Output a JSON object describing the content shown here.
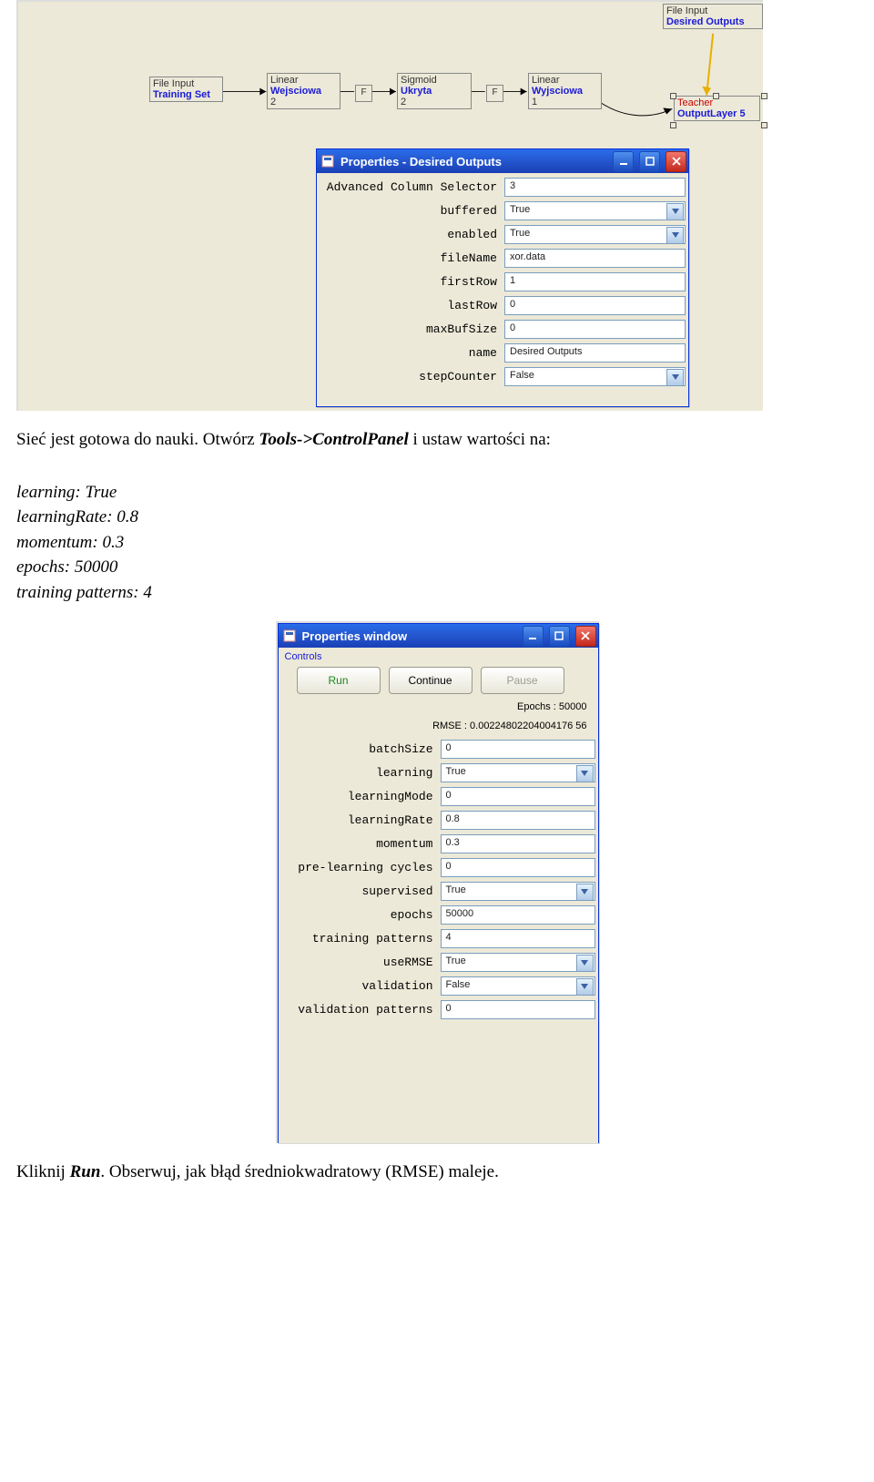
{
  "shot1": {
    "nodes": {
      "trainingSet": {
        "line1": "File Input",
        "line2": "Training Set"
      },
      "wejsciowa": {
        "line1": "Linear",
        "line2": "Wejsciowa",
        "line3": "2"
      },
      "ukryta": {
        "line1": "Sigmoid",
        "line2": "Ukryta",
        "line3": "2"
      },
      "wyjsciowa": {
        "line1": "Linear",
        "line2": "Wyjsciowa",
        "line3": "1"
      },
      "desired": {
        "line1": "File Input",
        "line2": "Desired Outputs"
      },
      "teacher": {
        "line1": "Teacher",
        "line2": "OutputLayer 5"
      },
      "fLabel": "F"
    },
    "dialog": {
      "title": "Properties - Desired Outputs",
      "rows": [
        {
          "label": "Advanced Column Selector",
          "value": "3",
          "type": "text"
        },
        {
          "label": "buffered",
          "value": "True",
          "type": "dropdown"
        },
        {
          "label": "enabled",
          "value": "True",
          "type": "dropdown"
        },
        {
          "label": "fileName",
          "value": "xor.data",
          "type": "text"
        },
        {
          "label": "firstRow",
          "value": "1",
          "type": "text"
        },
        {
          "label": "lastRow",
          "value": "0",
          "type": "text"
        },
        {
          "label": "maxBufSize",
          "value": "0",
          "type": "text"
        },
        {
          "label": "name",
          "value": "Desired Outputs",
          "type": "text"
        },
        {
          "label": "stepCounter",
          "value": "False",
          "type": "dropdown"
        }
      ]
    }
  },
  "body_text": {
    "p1a": "Sieć jest gotowa do nauki. Otwórz ",
    "p1b": "Tools->ControlPanel",
    "p1c": " i ustaw wartości na:",
    "params": [
      "learning: True",
      "learningRate: 0.8",
      "momentum: 0.3",
      "epochs: 50000",
      "training patterns: 4"
    ],
    "p2a": "Kliknij ",
    "p2b": "Run",
    "p2c": ". Obserwuj, jak błąd średniokwadratowy (RMSE) maleje."
  },
  "shot2": {
    "title": "Properties window",
    "subhead": "Controls",
    "buttons": {
      "run": "Run",
      "continue": "Continue",
      "pause": "Pause"
    },
    "readouts": {
      "epochs": "Epochs : 50000",
      "rmse": "RMSE : 0.00224802204004176 56"
    },
    "rows": [
      {
        "label": "batchSize",
        "value": "0",
        "type": "text"
      },
      {
        "label": "learning",
        "value": "True",
        "type": "dropdown"
      },
      {
        "label": "learningMode",
        "value": "0",
        "type": "text"
      },
      {
        "label": "learningRate",
        "value": "0.8",
        "type": "text"
      },
      {
        "label": "momentum",
        "value": "0.3",
        "type": "text"
      },
      {
        "label": "pre-learning cycles",
        "value": "0",
        "type": "text"
      },
      {
        "label": "supervised",
        "value": "True",
        "type": "dropdown"
      },
      {
        "label": "epochs",
        "value": "50000",
        "type": "text"
      },
      {
        "label": "training patterns",
        "value": "4",
        "type": "text"
      },
      {
        "label": "useRMSE",
        "value": "True",
        "type": "dropdown"
      },
      {
        "label": "validation",
        "value": "False",
        "type": "dropdown"
      },
      {
        "label": "validation patterns",
        "value": "0",
        "type": "text"
      }
    ]
  }
}
